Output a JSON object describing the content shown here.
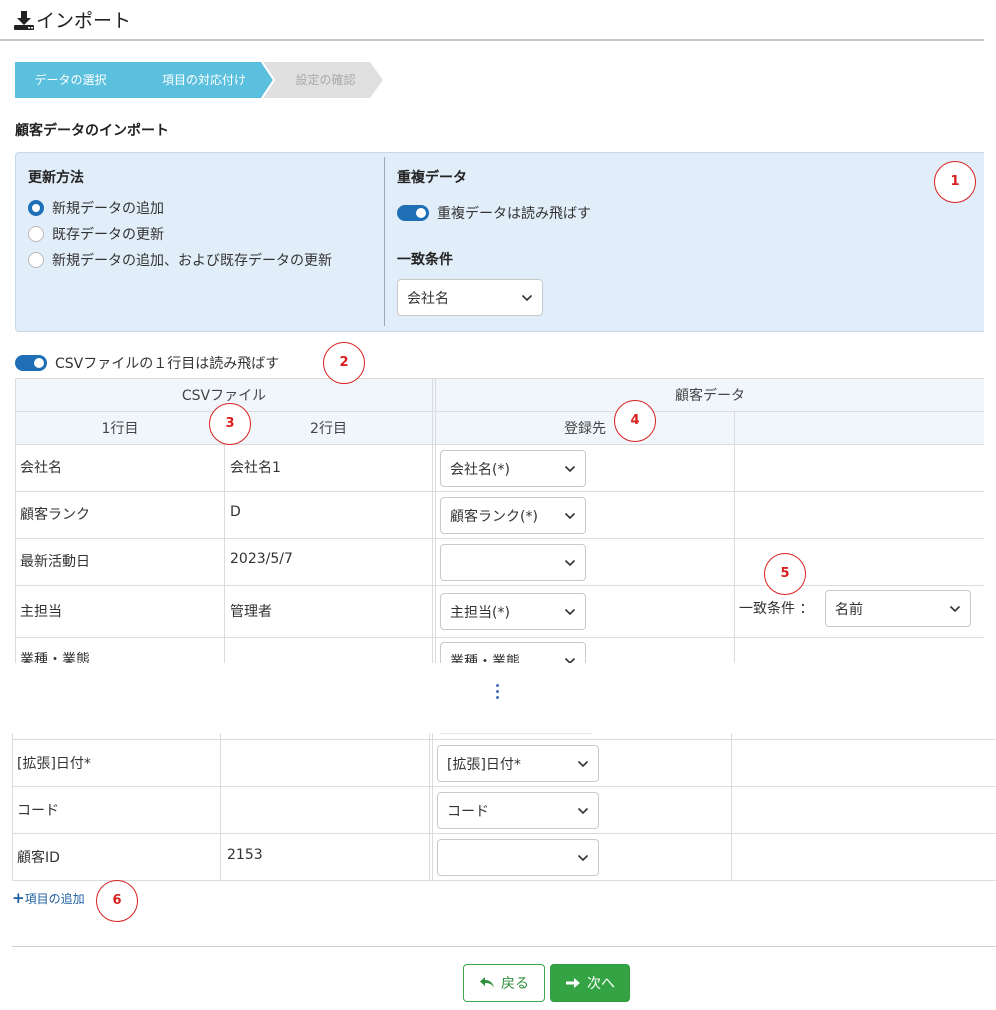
{
  "header": {
    "title": "インポート",
    "icon": "download-icon"
  },
  "steps": [
    {
      "label": "データの選択",
      "state": "done"
    },
    {
      "label": "項目の対応付け",
      "state": "current"
    },
    {
      "label": "設定の確認",
      "state": "pending"
    }
  ],
  "section_title": "顧客データのインポート",
  "update_method": {
    "title": "更新方法",
    "options": [
      {
        "label": "新規データの追加",
        "selected": true
      },
      {
        "label": "既存データの更新",
        "selected": false
      },
      {
        "label": "新規データの追加、および既存データの更新",
        "selected": false
      }
    ]
  },
  "duplicate": {
    "title": "重複データ",
    "toggle_label": "重複データは読み飛ばす",
    "toggle_on": true,
    "match_title": "一致条件",
    "match_value": "会社名"
  },
  "csv_skip": {
    "label": "CSVファイルの１行目は読み飛ばす",
    "on": true
  },
  "table": {
    "group_csv": "CSVファイル",
    "group_customer": "顧客データ",
    "col_row1": "1行目",
    "col_row2": "2行目",
    "col_dest": "登録先",
    "rows_top": [
      {
        "row1": "会社名",
        "row2": "会社名1",
        "dest": "会社名(*)"
      },
      {
        "row1": "顧客ランク",
        "row2": "D",
        "dest": "顧客ランク(*)"
      },
      {
        "row1": "最新活動日",
        "row2": "2023/5/7",
        "dest": ""
      },
      {
        "row1": "主担当",
        "row2": "管理者",
        "dest": "主担当(*)",
        "match_label": "一致条件 ：",
        "match_value": "名前"
      },
      {
        "row1": "業種・業態",
        "row2": "",
        "dest": "業種・業態"
      }
    ],
    "rows_bottom": [
      {
        "row1": "[拡張]日付*",
        "row2": "",
        "dest": "[拡張]日付*"
      },
      {
        "row1": "コード",
        "row2": "",
        "dest": "コード"
      },
      {
        "row1": "顧客ID",
        "row2": "2153",
        "dest": ""
      }
    ]
  },
  "add_item": {
    "plus": "+",
    "label": "項目の追加"
  },
  "buttons": {
    "back": "戻る",
    "next": "次へ"
  },
  "badges": [
    "1",
    "2",
    "3",
    "4",
    "5",
    "6"
  ],
  "colors": {
    "step_active": "#5bc0de",
    "step_pending": "#e0e0e0",
    "panel_bg": "#e1eef9",
    "toggle": "#1e6fb5",
    "badge": "#d92020",
    "primary_green": "#34a344"
  }
}
